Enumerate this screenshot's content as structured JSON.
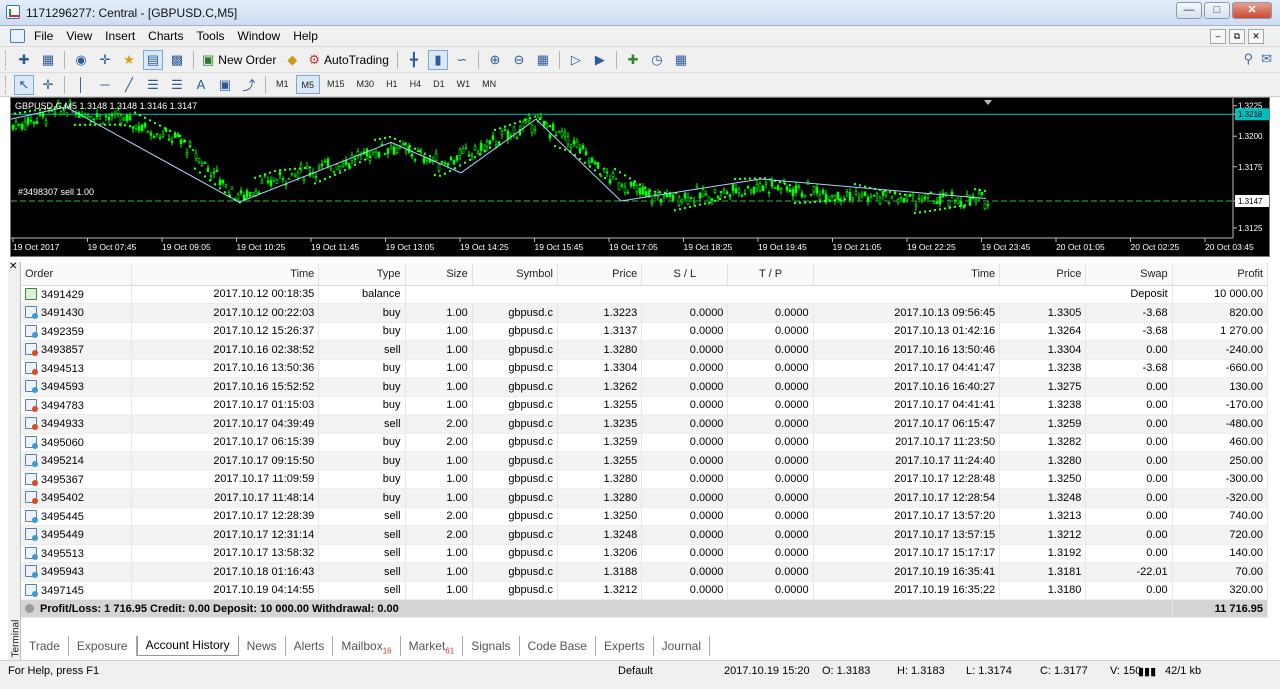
{
  "window": {
    "title": "1171296277: Central - [GBPUSD.C,M5]"
  },
  "menu": [
    "File",
    "View",
    "Insert",
    "Charts",
    "Tools",
    "Window",
    "Help"
  ],
  "toolbar": {
    "new_order": "New Order",
    "autotrading": "AutoTrading"
  },
  "timeframes": [
    "M1",
    "M5",
    "M15",
    "M30",
    "H1",
    "H4",
    "D1",
    "W1",
    "MN"
  ],
  "chart": {
    "header": "GBPUSD.C,M5  1.3148 1.3148 1.3146 1.3147",
    "trade_label": "#3498307 sell 1.00",
    "price_labels": [
      "1.3225",
      "1.3218",
      "1.3200",
      "1.3175",
      "1.3147",
      "1.3125"
    ],
    "time_labels": [
      "19 Oct 2017",
      "19 Oct 07:45",
      "19 Oct 09:05",
      "19 Oct 10:25",
      "19 Oct 11:45",
      "19 Oct 13:05",
      "19 Oct 14:25",
      "19 Oct 15:45",
      "19 Oct 17:05",
      "19 Oct 18:25",
      "19 Oct 19:45",
      "19 Oct 21:05",
      "19 Oct 22:25",
      "19 Oct 23:45",
      "20 Oct 01:05",
      "20 Oct 02:25",
      "20 Oct 03:45"
    ],
    "colors": {
      "background": "#000000",
      "candles": "#00ff00",
      "sar": "#33ff33",
      "hline": "#00bfbf",
      "zigzag": "#aad4ff"
    }
  },
  "table": {
    "columns": [
      "Order",
      "Time",
      "Type",
      "Size",
      "Symbol",
      "Price",
      "S / L",
      "T / P",
      "Time",
      "Price",
      "Swap",
      "Profit"
    ],
    "balance_row": {
      "order": "3491429",
      "time": "2017.10.12 00:18:35",
      "type": "balance",
      "comment": "Deposit",
      "profit": "10 000.00"
    },
    "rows": [
      {
        "order": "3491430",
        "time": "2017.10.12 00:22:03",
        "type": "buy",
        "size": "1.00",
        "symbol": "gbpusd.c",
        "price": "1.3223",
        "sl": "0.0000",
        "tp": "0.0000",
        "close_time": "2017.10.13 09:56:45",
        "close_price": "1.3305",
        "swap": "-3.68",
        "profit": "820.00"
      },
      {
        "order": "3492359",
        "time": "2017.10.12 15:26:37",
        "type": "buy",
        "size": "1.00",
        "symbol": "gbpusd.c",
        "price": "1.3137",
        "sl": "0.0000",
        "tp": "0.0000",
        "close_time": "2017.10.13 01:42:16",
        "close_price": "1.3264",
        "swap": "-3.68",
        "profit": "1 270.00"
      },
      {
        "order": "3493857",
        "time": "2017.10.16 02:38:52",
        "type": "sell",
        "size": "1.00",
        "symbol": "gbpusd.c",
        "price": "1.3280",
        "sl": "0.0000",
        "tp": "0.0000",
        "close_time": "2017.10.16 13:50:46",
        "close_price": "1.3304",
        "swap": "0.00",
        "profit": "-240.00"
      },
      {
        "order": "3494513",
        "time": "2017.10.16 13:50:36",
        "type": "buy",
        "size": "1.00",
        "symbol": "gbpusd.c",
        "price": "1.3304",
        "sl": "0.0000",
        "tp": "0.0000",
        "close_time": "2017.10.17 04:41:47",
        "close_price": "1.3238",
        "swap": "-3.68",
        "profit": "-660.00"
      },
      {
        "order": "3494593",
        "time": "2017.10.16 15:52:52",
        "type": "buy",
        "size": "1.00",
        "symbol": "gbpusd.c",
        "price": "1.3262",
        "sl": "0.0000",
        "tp": "0.0000",
        "close_time": "2017.10.16 16:40:27",
        "close_price": "1.3275",
        "swap": "0.00",
        "profit": "130.00"
      },
      {
        "order": "3494783",
        "time": "2017.10.17 01:15:03",
        "type": "buy",
        "size": "1.00",
        "symbol": "gbpusd.c",
        "price": "1.3255",
        "sl": "0.0000",
        "tp": "0.0000",
        "close_time": "2017.10.17 04:41:41",
        "close_price": "1.3238",
        "swap": "0.00",
        "profit": "-170.00"
      },
      {
        "order": "3494933",
        "time": "2017.10.17 04:39:49",
        "type": "sell",
        "size": "2.00",
        "symbol": "gbpusd.c",
        "price": "1.3235",
        "sl": "0.0000",
        "tp": "0.0000",
        "close_time": "2017.10.17 06:15:47",
        "close_price": "1.3259",
        "swap": "0.00",
        "profit": "-480.00"
      },
      {
        "order": "3495060",
        "time": "2017.10.17 06:15:39",
        "type": "buy",
        "size": "2.00",
        "symbol": "gbpusd.c",
        "price": "1.3259",
        "sl": "0.0000",
        "tp": "0.0000",
        "close_time": "2017.10.17 11:23:50",
        "close_price": "1.3282",
        "swap": "0.00",
        "profit": "460.00"
      },
      {
        "order": "3495214",
        "time": "2017.10.17 09:15:50",
        "type": "buy",
        "size": "1.00",
        "symbol": "gbpusd.c",
        "price": "1.3255",
        "sl": "0.0000",
        "tp": "0.0000",
        "close_time": "2017.10.17 11:24:40",
        "close_price": "1.3280",
        "swap": "0.00",
        "profit": "250.00"
      },
      {
        "order": "3495367",
        "time": "2017.10.17 11:09:59",
        "type": "buy",
        "size": "1.00",
        "symbol": "gbpusd.c",
        "price": "1.3280",
        "sl": "0.0000",
        "tp": "0.0000",
        "close_time": "2017.10.17 12:28:48",
        "close_price": "1.3250",
        "swap": "0.00",
        "profit": "-300.00"
      },
      {
        "order": "3495402",
        "time": "2017.10.17 11:48:14",
        "type": "buy",
        "size": "1.00",
        "symbol": "gbpusd.c",
        "price": "1.3280",
        "sl": "0.0000",
        "tp": "0.0000",
        "close_time": "2017.10.17 12:28:54",
        "close_price": "1.3248",
        "swap": "0.00",
        "profit": "-320.00"
      },
      {
        "order": "3495445",
        "time": "2017.10.17 12:28:39",
        "type": "sell",
        "size": "2.00",
        "symbol": "gbpusd.c",
        "price": "1.3250",
        "sl": "0.0000",
        "tp": "0.0000",
        "close_time": "2017.10.17 13:57:20",
        "close_price": "1.3213",
        "swap": "0.00",
        "profit": "740.00"
      },
      {
        "order": "3495449",
        "time": "2017.10.17 12:31:14",
        "type": "sell",
        "size": "2.00",
        "symbol": "gbpusd.c",
        "price": "1.3248",
        "sl": "0.0000",
        "tp": "0.0000",
        "close_time": "2017.10.17 13:57:15",
        "close_price": "1.3212",
        "swap": "0.00",
        "profit": "720.00"
      },
      {
        "order": "3495513",
        "time": "2017.10.17 13:58:32",
        "type": "sell",
        "size": "1.00",
        "symbol": "gbpusd.c",
        "price": "1.3206",
        "sl": "0.0000",
        "tp": "0.0000",
        "close_time": "2017.10.17 15:17:17",
        "close_price": "1.3192",
        "swap": "0.00",
        "profit": "140.00"
      },
      {
        "order": "3495943",
        "time": "2017.10.18 01:16:43",
        "type": "sell",
        "size": "1.00",
        "symbol": "gbpusd.c",
        "price": "1.3188",
        "sl": "0.0000",
        "tp": "0.0000",
        "close_time": "2017.10.19 16:35:41",
        "close_price": "1.3181",
        "swap": "-22.01",
        "profit": "70.00"
      },
      {
        "order": "3497145",
        "time": "2017.10.19 04:14:55",
        "type": "sell",
        "size": "1.00",
        "symbol": "gbpusd.c",
        "price": "1.3212",
        "sl": "0.0000",
        "tp": "0.0000",
        "close_time": "2017.10.19 16:35:22",
        "close_price": "1.3180",
        "swap": "0.00",
        "profit": "320.00"
      }
    ],
    "summary": {
      "text": "Profit/Loss: 1 716.95  Credit: 0.00  Deposit: 10 000.00  Withdrawal: 0.00",
      "total": "11 716.95"
    }
  },
  "terminal_label": "Terminal",
  "tabs": [
    {
      "label": "Trade",
      "badge": ""
    },
    {
      "label": "Exposure",
      "badge": ""
    },
    {
      "label": "Account History",
      "badge": "",
      "active": true
    },
    {
      "label": "News",
      "badge": ""
    },
    {
      "label": "Alerts",
      "badge": ""
    },
    {
      "label": "Mailbox",
      "badge": "16"
    },
    {
      "label": "Market",
      "badge": "61"
    },
    {
      "label": "Signals",
      "badge": ""
    },
    {
      "label": "Code Base",
      "badge": ""
    },
    {
      "label": "Experts",
      "badge": ""
    },
    {
      "label": "Journal",
      "badge": ""
    }
  ],
  "status": {
    "help": "For Help, press F1",
    "profile": "Default",
    "datetime": "2017.10.19 15:20",
    "open": "O: 1.3183",
    "high": "H: 1.3183",
    "low": "L: 1.3174",
    "close": "C: 1.3177",
    "volume": "V: 150",
    "traffic": "42/1 kb"
  }
}
